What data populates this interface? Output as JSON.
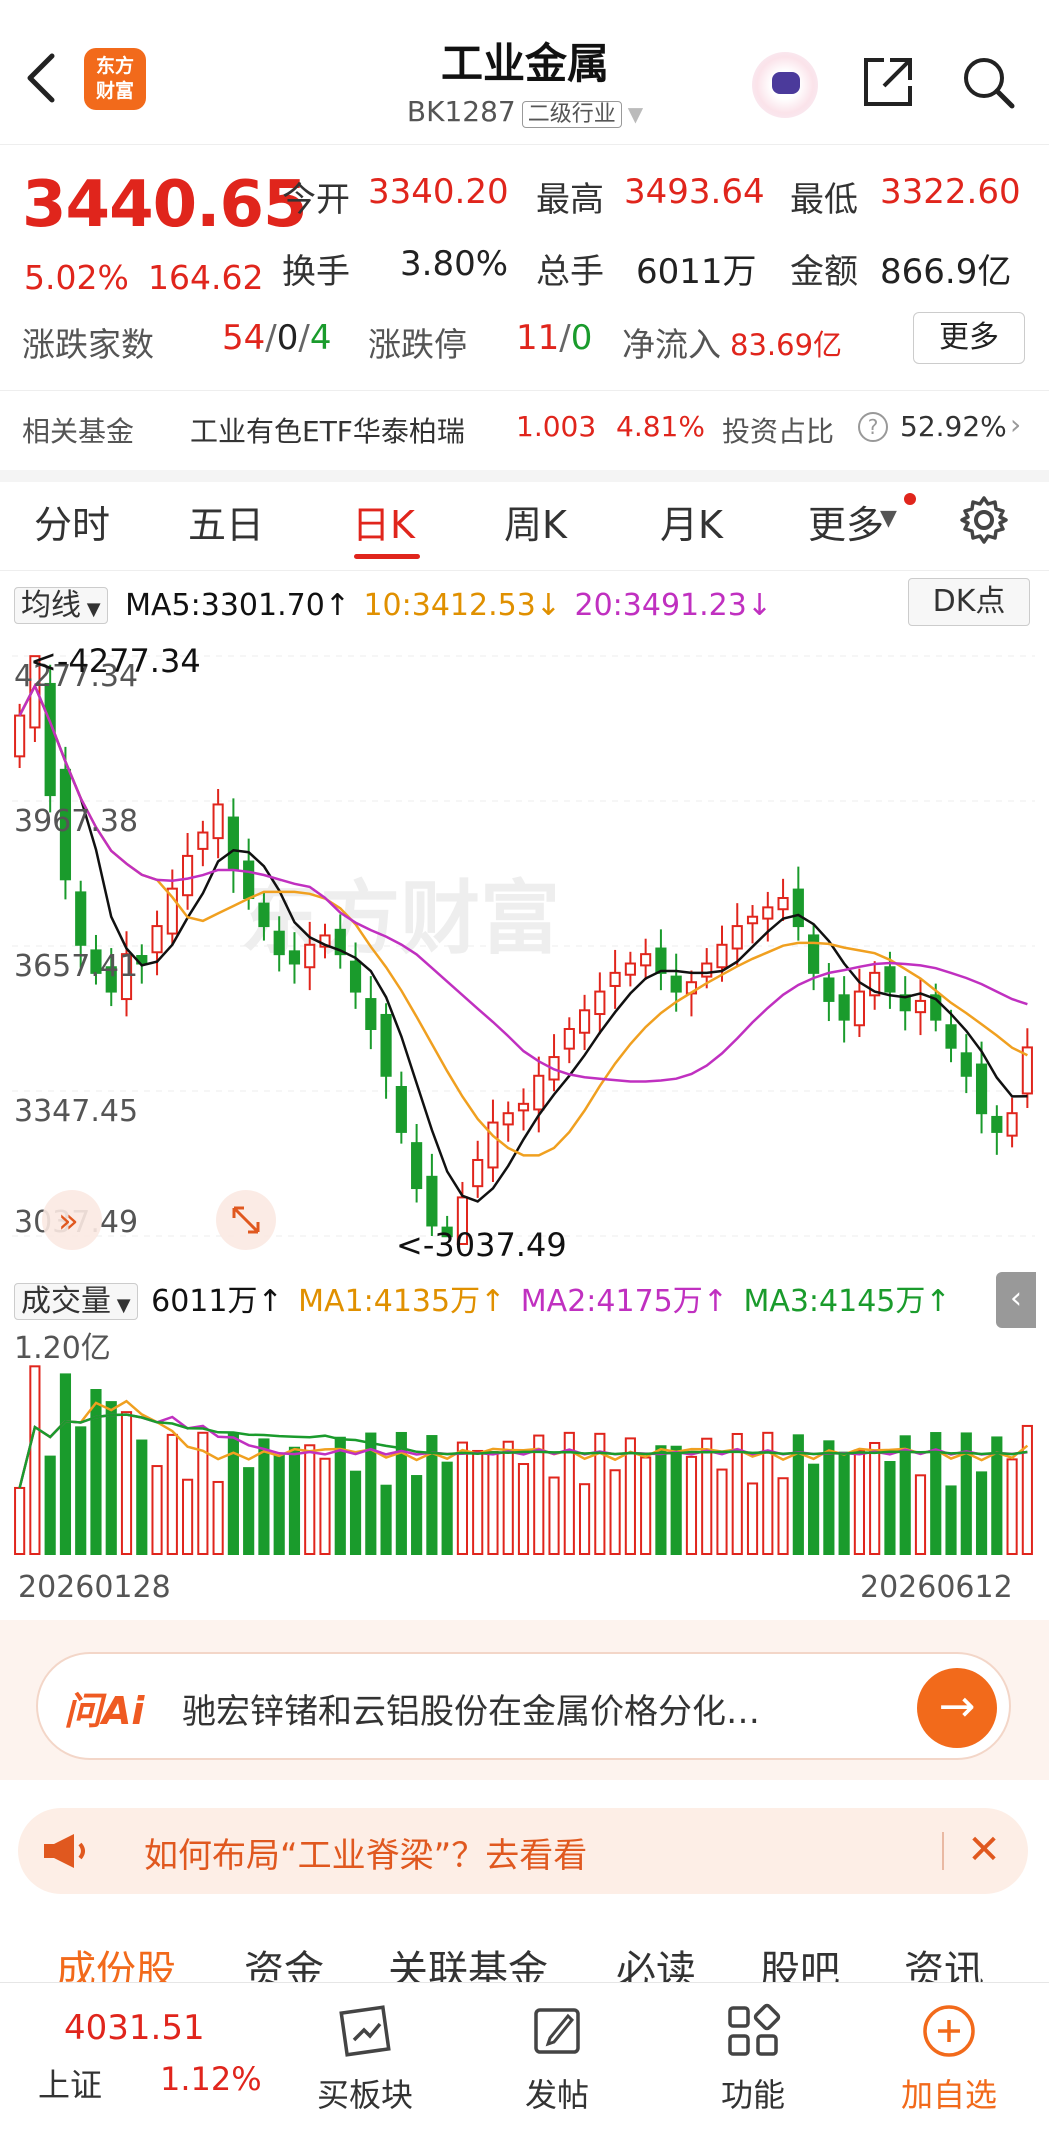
{
  "header": {
    "title": "工业金属",
    "code": "BK1287",
    "category": "二级行业",
    "logo_text_1": "东方",
    "logo_text_2": "财富"
  },
  "quote": {
    "price": "3440.65",
    "change_pct": "5.02%",
    "change_amt": "164.62",
    "open_label": "今开",
    "open": "3340.20",
    "high_label": "最高",
    "high": "3493.64",
    "low_label": "最低",
    "low": "3322.60",
    "turnover_label": "换手",
    "turnover": "3.80%",
    "volume_label": "总手",
    "volume": "6011万",
    "amount_label": "金额",
    "amount": "866.9亿",
    "breadth_label": "涨跌家数",
    "breadth_up": "54",
    "breadth_flat": "0",
    "breadth_down": "4",
    "limit_label": "涨跌停",
    "limit_up": "11",
    "limit_down": "0",
    "netflow_label": "净流入",
    "netflow": "83.69亿",
    "more_label": "更多"
  },
  "fund": {
    "label": "相关基金",
    "name": "工业有色ETF华泰柏瑞",
    "nav": "1.003",
    "pct": "4.81%",
    "ratio_label": "投资占比",
    "ratio": "52.92%"
  },
  "tabs": [
    "分时",
    "五日",
    "日K",
    "周K",
    "月K",
    "更多"
  ],
  "ma": {
    "selector": "均线",
    "ma5": "MA5:3301.70↑",
    "ma10": "10:3412.53↓",
    "ma20": "20:3491.23↓",
    "dk": "DK点"
  },
  "kline": {
    "high_mark": "<-4277.34",
    "low_mark": "<-3037.49",
    "y_labels": [
      "4277.34",
      "3967.38",
      "3657.41",
      "3347.45",
      "3037.49"
    ]
  },
  "volume": {
    "selector": "成交量",
    "value": "6011万↑",
    "ma1": "MA1:4135万↑",
    "ma2": "MA2:4175万↑",
    "ma3": "MA3:4145万↑",
    "y_label": "1.20亿",
    "start_date": "20260128",
    "end_date": "20260612"
  },
  "ai": {
    "logo": "问Ai",
    "text": "驰宏锌锗和云铝股份在金属价格分化…"
  },
  "promo": {
    "text": "如何布局“工业脊梁”？去看看"
  },
  "bottom_tabs": [
    "成份股",
    "资金",
    "关联基金",
    "必读",
    "股吧",
    "资讯"
  ],
  "footer": {
    "index_value": "4031.51",
    "index_name": "上证",
    "index_pct": "1.12%",
    "buttons": [
      "买板块",
      "发帖",
      "功能",
      "加自选"
    ]
  },
  "colors": {
    "up": "#e0251c",
    "down": "#1a9b2c",
    "ma5": "#111111",
    "ma10": "#f0a020",
    "ma20": "#c030c0",
    "accent": "#f26a1b"
  },
  "chart_data": {
    "type": "candlestick",
    "y_range": [
      3037.49,
      4277.34
    ],
    "x_range": [
      "20260128",
      "20260612"
    ],
    "close_series_approx": [
      4150,
      4277,
      3980,
      3800,
      3660,
      3600,
      3560,
      3640,
      3620,
      3700,
      3780,
      3850,
      3900,
      3960,
      3820,
      3760,
      3700,
      3640,
      3620,
      3660,
      3680,
      3640,
      3560,
      3480,
      3380,
      3260,
      3140,
      3060,
      3037,
      3120,
      3200,
      3280,
      3300,
      3320,
      3380,
      3420,
      3480,
      3520,
      3560,
      3600,
      3620,
      3640,
      3600,
      3560,
      3580,
      3620,
      3660,
      3700,
      3720,
      3740,
      3760,
      3700,
      3600,
      3540,
      3500,
      3560,
      3600,
      3560,
      3520,
      3540,
      3500,
      3440,
      3380,
      3300,
      3260,
      3300,
      3440.65
    ]
  }
}
